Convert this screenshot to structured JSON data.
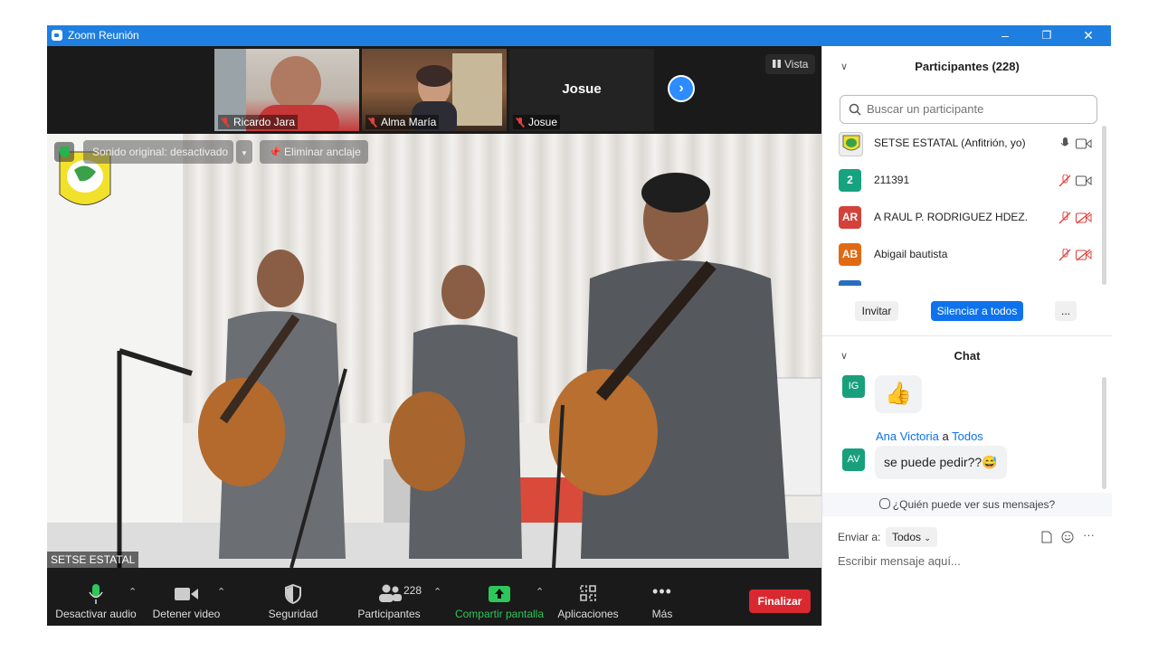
{
  "window": {
    "title": "Zoom Reunión",
    "controls": [
      "–",
      "❐",
      "✕"
    ]
  },
  "thumbnails": [
    {
      "name": "Ricardo Jara",
      "muted": true
    },
    {
      "name": "Alma María",
      "muted": true
    },
    {
      "name": "Josue",
      "muted": true,
      "caption": "Josue"
    }
  ],
  "view_button": "Vista",
  "main_video": {
    "original_sound": "Sonido original: desactivado",
    "unpin": "Eliminar anclaje",
    "speaker_label": "SETSE ESTATAL"
  },
  "toolbar": {
    "mute": "Desactivar audio",
    "stop_video": "Detener video",
    "security": "Seguridad",
    "participants": "Participantes",
    "participants_count": "228",
    "share": "Compartir pantalla",
    "apps": "Aplicaciones",
    "more": "Más",
    "end": "Finalizar"
  },
  "participants_panel": {
    "title": "Participantes (228)",
    "search_placeholder": "Buscar un participante",
    "rows": [
      {
        "initials": "",
        "name": "SETSE ESTATAL (Anfitrión, yo)",
        "color": "#f2f2f2"
      },
      {
        "initials": "2",
        "name": "211391",
        "color": "#16a37f"
      },
      {
        "initials": "AR",
        "name": "A RAUL P. RODRIGUEZ HDEZ.",
        "color": "#d2423b"
      },
      {
        "initials": "AB",
        "name": "Abigail bautista",
        "color": "#e06a14"
      }
    ],
    "invite": "Invitar",
    "mute_all": "Silenciar a todos",
    "more": "..."
  },
  "chat": {
    "title": "Chat",
    "messages": [
      {
        "initials": "IG",
        "text": "👍"
      },
      {
        "initials": "AV",
        "sender": "Ana Victoria",
        "connector": "a",
        "recipient": "Todos",
        "text": "se puede pedir??😅"
      }
    ],
    "who_can_see": "¿Quién puede ver sus mensajes?",
    "send_to_label": "Enviar a:",
    "send_to_value": "Todos",
    "input_placeholder": "Escribir mensaje aquí..."
  }
}
